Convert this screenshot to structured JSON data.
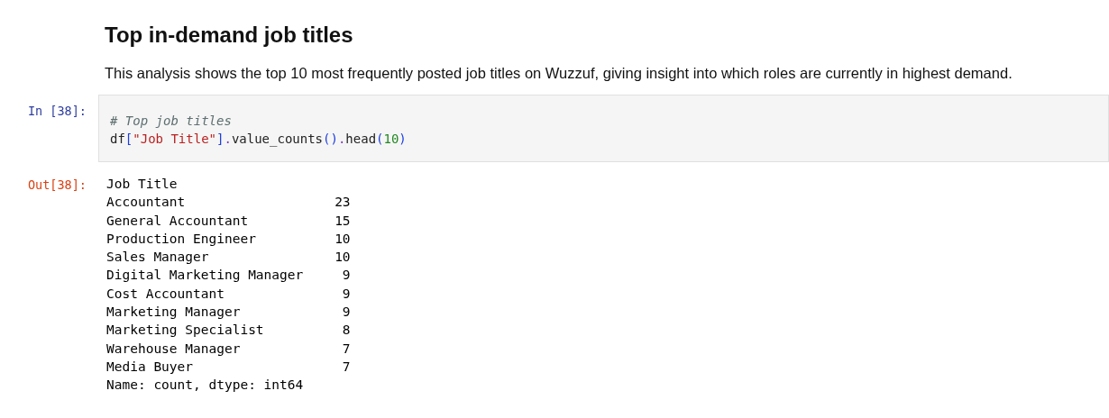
{
  "heading": "Top in-demand job titles",
  "description": "This analysis shows the top 10 most frequently posted job titles on Wuzzuf, giving insight into which roles are currently in highest demand.",
  "input_cell": {
    "prompt": "In [38]:",
    "lines": [
      [
        {
          "kind": "comment",
          "text": "# Top job titles"
        }
      ],
      [
        {
          "kind": "name",
          "text": "df"
        },
        {
          "kind": "punct",
          "text": "["
        },
        {
          "kind": "string",
          "text": "\"Job Title\""
        },
        {
          "kind": "punct",
          "text": "]"
        },
        {
          "kind": "op",
          "text": "."
        },
        {
          "kind": "name",
          "text": "value_counts"
        },
        {
          "kind": "punct",
          "text": "()"
        },
        {
          "kind": "op",
          "text": "."
        },
        {
          "kind": "name",
          "text": "head"
        },
        {
          "kind": "punct",
          "text": "("
        },
        {
          "kind": "number",
          "text": "10"
        },
        {
          "kind": "punct",
          "text": ")"
        }
      ]
    ]
  },
  "output_cell": {
    "prompt": "Out[38]:",
    "header": "Job Title",
    "rows": [
      {
        "title": "Accountant",
        "count": "23"
      },
      {
        "title": "General Accountant",
        "count": "15"
      },
      {
        "title": "Production Engineer",
        "count": "10"
      },
      {
        "title": "Sales Manager",
        "count": "10"
      },
      {
        "title": "Digital Marketing Manager",
        "count": "9"
      },
      {
        "title": "Cost Accountant",
        "count": "9"
      },
      {
        "title": "Marketing Manager",
        "count": "9"
      },
      {
        "title": "Marketing Specialist",
        "count": "8"
      },
      {
        "title": "Warehouse Manager",
        "count": "7"
      },
      {
        "title": "Media Buyer",
        "count": "7"
      }
    ],
    "footer": "Name: count, dtype: int64"
  }
}
